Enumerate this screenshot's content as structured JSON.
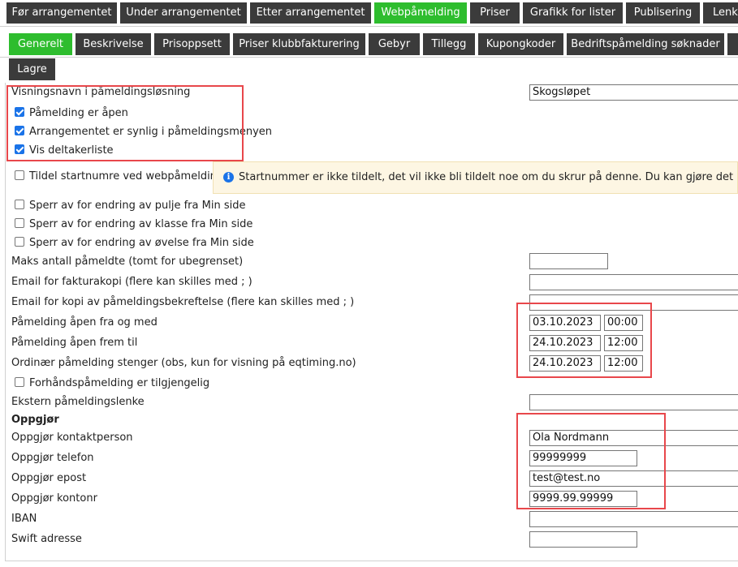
{
  "top_tabs": [
    {
      "label": "Før arrangementet",
      "active": false
    },
    {
      "label": "Under arrangementet",
      "active": false
    },
    {
      "label": "Etter arrangementet",
      "active": false
    },
    {
      "label": "Webpåmelding",
      "active": true
    },
    {
      "label": "Priser",
      "active": false
    },
    {
      "label": "Grafikk for lister",
      "active": false
    },
    {
      "label": "Publisering",
      "active": false
    },
    {
      "label": "Lenke",
      "active": false
    }
  ],
  "sub_tabs": [
    {
      "label": "Generelt",
      "active": true
    },
    {
      "label": "Beskrivelse",
      "active": false
    },
    {
      "label": "Prisoppsett",
      "active": false
    },
    {
      "label": "Priser klubbfakturering",
      "active": false
    },
    {
      "label": "Gebyr",
      "active": false
    },
    {
      "label": "Tillegg",
      "active": false
    },
    {
      "label": "Kupongkoder",
      "active": false
    },
    {
      "label": "Bedriftspåmelding søknader",
      "active": false
    }
  ],
  "save_label": "Lagre",
  "form": {
    "display_name_label": "Visningsnavn i påmeldingsløsning",
    "display_name_value": "Skogsløpet",
    "cb_open": {
      "label": "Påmelding er åpen",
      "checked": true
    },
    "cb_visible": {
      "label": "Arrangementet er synlig i påmeldingsmenyen",
      "checked": true
    },
    "cb_participants": {
      "label": "Vis deltakerliste",
      "checked": true
    },
    "cb_startnumbers": {
      "label": "Tildel startnumre ved webpåmelding",
      "checked": false
    },
    "info_text": "Startnummer er ikke tildelt, det vil ikke bli tildelt noe om du skrur på denne. Du kan gjøre det under f",
    "cb_lock_pool": {
      "label": "Sperr av for endring av pulje fra Min side",
      "checked": false
    },
    "cb_lock_class": {
      "label": "Sperr av for endring av klasse fra Min side",
      "checked": false
    },
    "cb_lock_exercise": {
      "label": "Sperr av for endring av øvelse fra Min side",
      "checked": false
    },
    "max_label": "Maks antall påmeldte (tomt for ubegrenset)",
    "max_value": "",
    "invoice_email_label": "Email for fakturakopi (flere kan skilles med ; )",
    "invoice_email_value": "",
    "confirm_email_label": "Email for kopi av påmeldingsbekreftelse (flere kan skilles med ; )",
    "confirm_email_value": "",
    "open_from_label": "Påmelding åpen fra og med",
    "open_from_date": "03.10.2023",
    "open_from_time": "00:00",
    "open_until_label": "Påmelding åpen frem til",
    "open_until_date": "24.10.2023",
    "open_until_time": "12:00",
    "closes_label": "Ordinær påmelding stenger (obs, kun for visning på eqtiming.no)",
    "closes_date": "24.10.2023",
    "closes_time": "12:00",
    "cb_preregistration": {
      "label": "Forhåndspåmelding er tilgjengelig",
      "checked": false
    },
    "external_link_label": "Ekstern påmeldingslenke",
    "external_link_value": "",
    "settlement_heading": "Oppgjør",
    "contact_label": "Oppgjør kontaktperson",
    "contact_value": "Ola Nordmann",
    "phone_label": "Oppgjør telefon",
    "phone_value": "99999999",
    "email_label": "Oppgjør epost",
    "email_value": "test@test.no",
    "account_label": "Oppgjør kontonr",
    "account_value": "9999.99.99999",
    "iban_label": "IBAN",
    "iban_value": "",
    "swift_label": "Swift adresse",
    "swift_value": ""
  },
  "colors": {
    "tab_bg": "#3b3b3b",
    "tab_active_bg": "#2ebd2e",
    "highlight_red": "#e8474b",
    "info_bg": "#fdf6e3",
    "checkbox_blue": "#1a73e8"
  },
  "icons": {
    "info": "info-icon",
    "checkbox": "checkbox-icon"
  }
}
